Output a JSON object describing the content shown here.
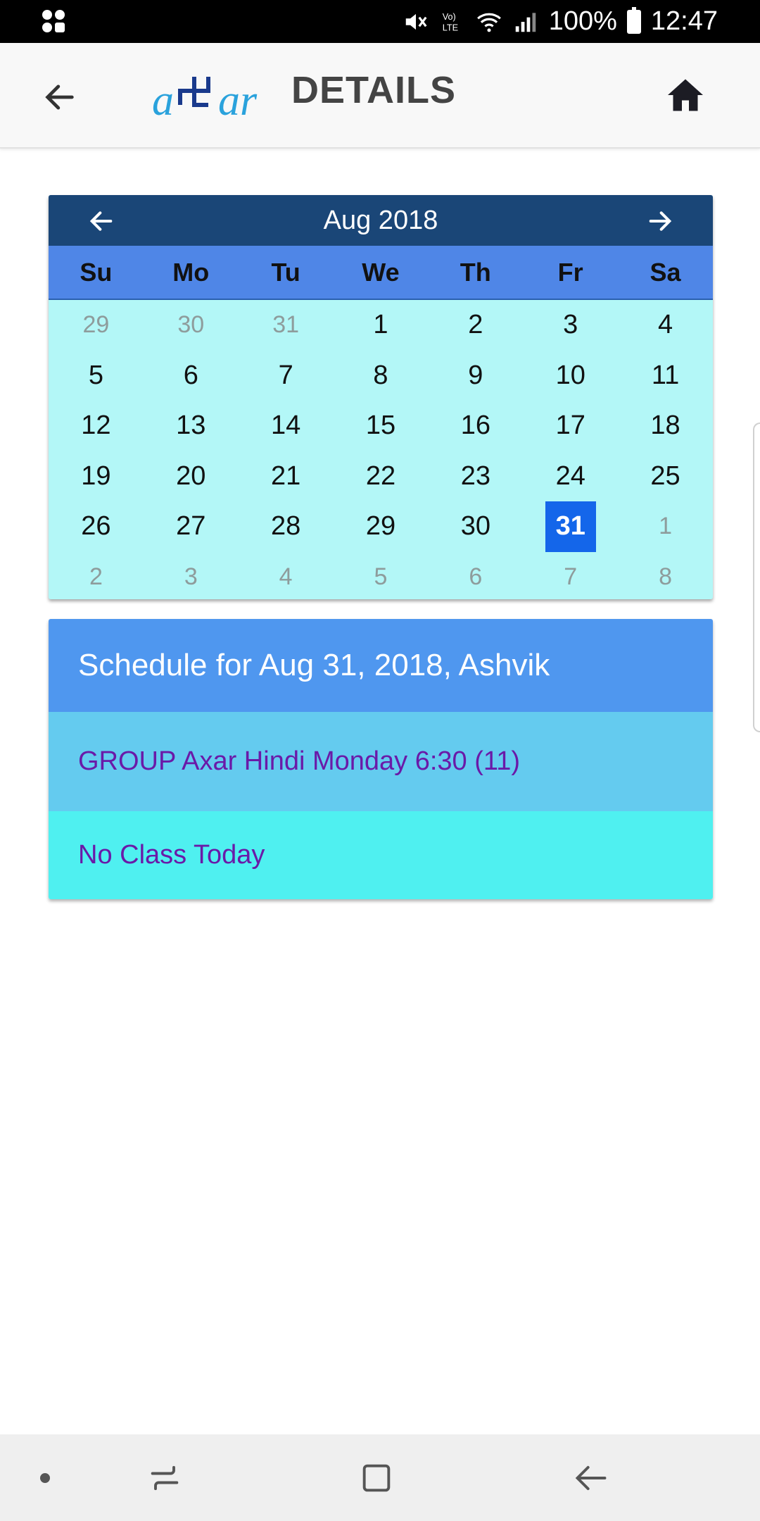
{
  "status_bar": {
    "battery": "100%",
    "time": "12:47",
    "icons": [
      "notification-app-icon",
      "mute-icon",
      "volte-icon",
      "wifi-icon",
      "signal-icon",
      "battery-icon"
    ]
  },
  "app_bar": {
    "title": "DETAILS",
    "logo_text": "axar",
    "back_icon": "arrow-left-icon",
    "home_icon": "home-icon"
  },
  "calendar": {
    "month_label": "Aug 2018",
    "weekdays": [
      "Su",
      "Mo",
      "Tu",
      "We",
      "Th",
      "Fr",
      "Sa"
    ],
    "selected_day": "31",
    "days": [
      {
        "d": "29",
        "other": true
      },
      {
        "d": "30",
        "other": true
      },
      {
        "d": "31",
        "other": true
      },
      {
        "d": "1"
      },
      {
        "d": "2"
      },
      {
        "d": "3"
      },
      {
        "d": "4"
      },
      {
        "d": "5"
      },
      {
        "d": "6"
      },
      {
        "d": "7"
      },
      {
        "d": "8"
      },
      {
        "d": "9"
      },
      {
        "d": "10"
      },
      {
        "d": "11"
      },
      {
        "d": "12"
      },
      {
        "d": "13"
      },
      {
        "d": "14"
      },
      {
        "d": "15"
      },
      {
        "d": "16"
      },
      {
        "d": "17"
      },
      {
        "d": "18"
      },
      {
        "d": "19"
      },
      {
        "d": "20"
      },
      {
        "d": "21"
      },
      {
        "d": "22"
      },
      {
        "d": "23"
      },
      {
        "d": "24"
      },
      {
        "d": "25"
      },
      {
        "d": "26"
      },
      {
        "d": "27"
      },
      {
        "d": "28"
      },
      {
        "d": "29"
      },
      {
        "d": "30"
      },
      {
        "d": "31",
        "selected": true
      },
      {
        "d": "1",
        "other": true
      },
      {
        "d": "2",
        "other": true
      },
      {
        "d": "3",
        "other": true
      },
      {
        "d": "4",
        "other": true
      },
      {
        "d": "5",
        "other": true
      },
      {
        "d": "6",
        "other": true
      },
      {
        "d": "7",
        "other": true
      },
      {
        "d": "8",
        "other": true
      }
    ],
    "colors": {
      "header": "#1a4677",
      "weekday_bar": "#4f86e7",
      "body": "#b3f7f7",
      "selected": "#1466ea"
    }
  },
  "schedule": {
    "heading": "Schedule for Aug 31, 2018, Ashvik",
    "group": "GROUP Axar Hindi Monday 6:30 (11)",
    "status": "No Class Today",
    "colors": {
      "heading_bg": "#4f97ef",
      "group_bg": "#64cbef",
      "status_bg": "#4ff0f0",
      "text": "#6a1aa8"
    }
  },
  "nav_bar": {
    "icons": [
      "dot-icon",
      "recent-apps-icon",
      "home-square-icon",
      "back-nav-icon"
    ]
  }
}
